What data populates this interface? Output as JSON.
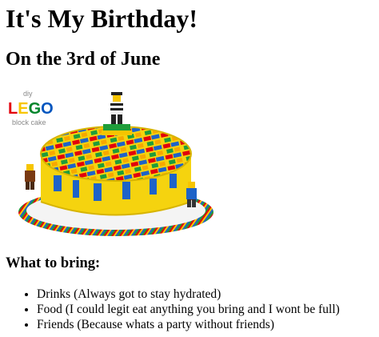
{
  "page": {
    "title": "It's My Birthday!",
    "subtitle": "On the 3rd of June"
  },
  "image": {
    "logo_top": "diy",
    "logo_brand": "LEGO",
    "logo_bottom": "block cake",
    "logo_colors": [
      "#e3000b",
      "#f7c500",
      "#00852b",
      "#0055bf"
    ],
    "icon": "lego-cake-photo"
  },
  "bring": {
    "heading": "What to bring:",
    "items": [
      "Drinks (Always got to stay hydrated)",
      "Food (I could legit eat anything you bring and I wont be full)",
      "Friends (Because whats a party without friends)"
    ]
  },
  "colors": {
    "cake_yellow": "#f5d30f",
    "brick_red": "#e3000b",
    "brick_blue": "#1e63c8",
    "brick_green": "#1f9d3a",
    "board_stripes": [
      "#e3000b",
      "#f7c500",
      "#1e63c8",
      "#1f9d3a"
    ]
  }
}
